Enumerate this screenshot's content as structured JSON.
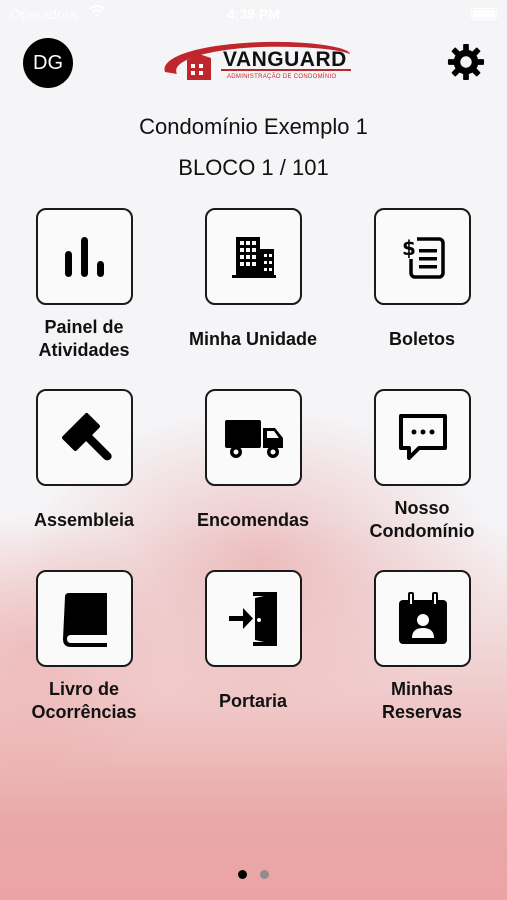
{
  "status_bar": {
    "carrier": "Operadora",
    "time": "4:39 PM"
  },
  "header": {
    "avatar_initials": "DG",
    "logo_text": "VANGUARD",
    "logo_subtitle": "ADMINISTRAÇÃO DE CONDOMÍNIO",
    "settings_icon": "gear-icon"
  },
  "condo": {
    "name": "Condomínio Exemplo 1",
    "unit": "BLOCO 1 / 101"
  },
  "tiles": [
    {
      "label_1": "Painel de",
      "label_2": "Atividades",
      "icon": "bar-chart-icon"
    },
    {
      "label_1": "Minha Unidade",
      "label_2": "",
      "icon": "building-icon"
    },
    {
      "label_1": "Boletos",
      "label_2": "",
      "icon": "invoice-icon"
    },
    {
      "label_1": "Assembleia",
      "label_2": "",
      "icon": "gavel-icon"
    },
    {
      "label_1": "Encomendas",
      "label_2": "",
      "icon": "truck-icon"
    },
    {
      "label_1": "Nosso",
      "label_2": "Condomínio",
      "icon": "chat-icon"
    },
    {
      "label_1": "Livro de",
      "label_2": "Ocorrências",
      "icon": "book-icon"
    },
    {
      "label_1": "Portaria",
      "label_2": "",
      "icon": "door-enter-icon"
    },
    {
      "label_1": "Minhas",
      "label_2": "Reservas",
      "icon": "calendar-person-icon"
    }
  ],
  "pager": {
    "active_page": 1,
    "total_pages": 2
  },
  "colors": {
    "brand_red": "#c0272d",
    "dot_active": "#000000",
    "dot_inactive": "#8e8e8e"
  }
}
